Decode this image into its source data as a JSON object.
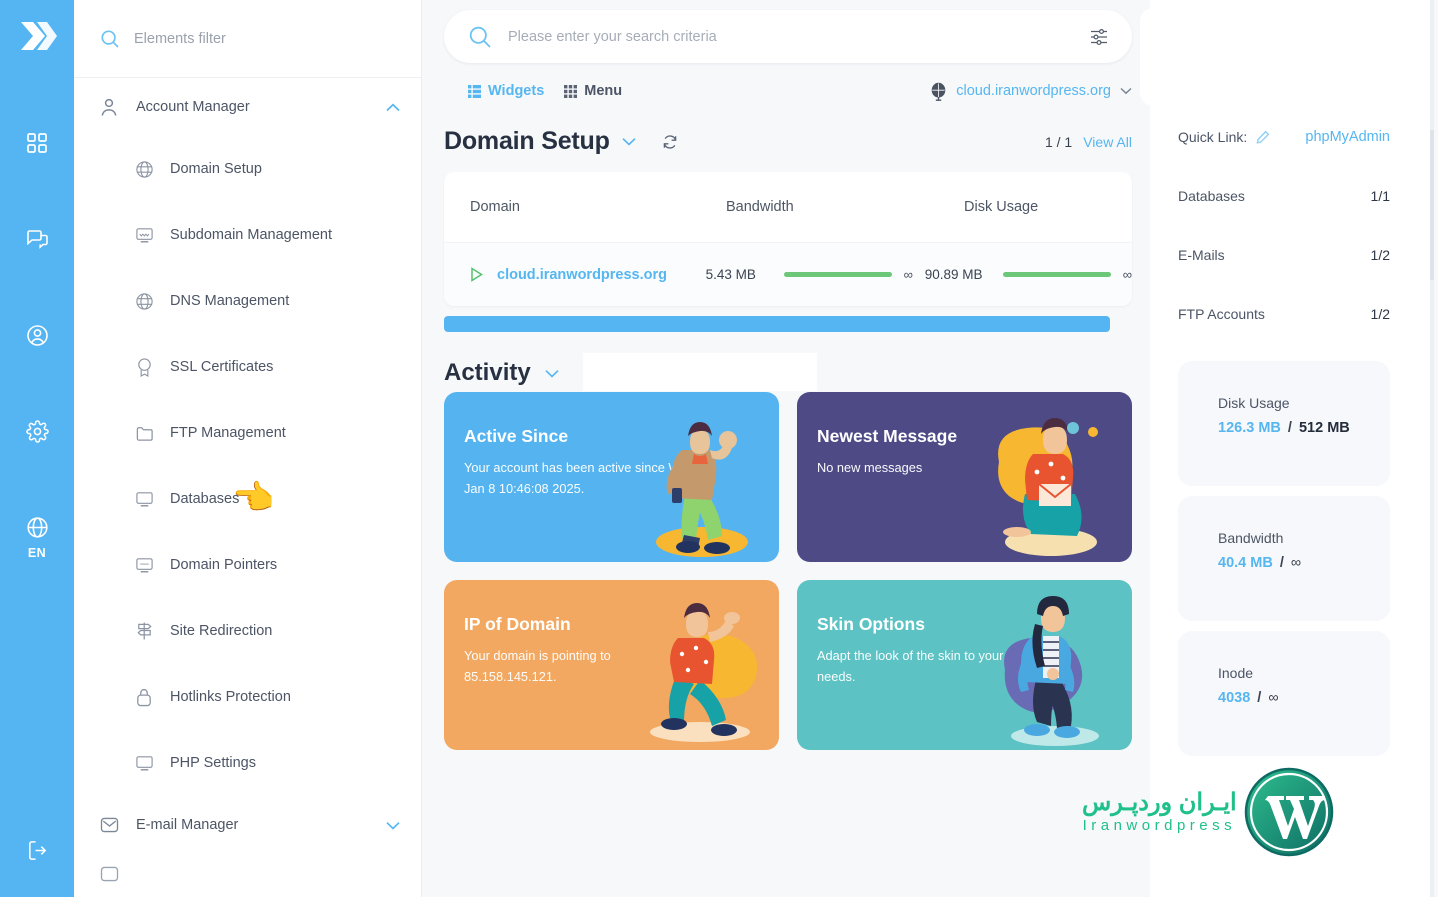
{
  "rail": {
    "logo_name": "directadmin-logo",
    "items": [
      {
        "name": "dashboard-icon",
        "label": "Dashboard"
      },
      {
        "name": "chat-icon",
        "label": "Messages"
      },
      {
        "name": "user-icon",
        "label": "Account"
      },
      {
        "name": "gear-icon",
        "label": "Settings"
      },
      {
        "name": "globe-icon",
        "label": "Language"
      },
      {
        "name": "logout-icon",
        "label": "Logout"
      }
    ],
    "language": "EN"
  },
  "nav": {
    "filter_placeholder": "Elements filter",
    "groups": [
      {
        "label": "Account Manager",
        "icon": "user-outline-icon",
        "expanded": true,
        "chevron": "⌃",
        "items": [
          {
            "label": "Domain Setup",
            "icon": "www-globe-icon"
          },
          {
            "label": "Subdomain Management",
            "icon": "dns-monitor-icon"
          },
          {
            "label": "DNS Management",
            "icon": "dns-globe-icon"
          },
          {
            "label": "SSL Certificates",
            "icon": "ssl-badge-icon"
          },
          {
            "label": "FTP Management",
            "icon": "ftp-folder-icon"
          },
          {
            "label": "Databases",
            "icon": "sql-database-icon"
          },
          {
            "label": "Domain Pointers",
            "icon": "pointer-monitor-icon"
          },
          {
            "label": "Site Redirection",
            "icon": "signpost-icon"
          },
          {
            "label": "Hotlinks Protection",
            "icon": "lock-icon"
          },
          {
            "label": "PHP Settings",
            "icon": "php-monitor-icon"
          }
        ]
      },
      {
        "label": "E-mail Manager",
        "icon": "envelope-icon",
        "expanded": false,
        "chevron": "⌄",
        "items": []
      }
    ],
    "cursor_emoji": "👈"
  },
  "search": {
    "placeholder": "Please enter your search criteria",
    "search_icon": "search-icon",
    "filter_icon": "sliders-icon"
  },
  "toolbar": {
    "widgets_label": "Widgets",
    "menu_label": "Menu",
    "domain": "cloud.iranwordpress.org"
  },
  "section": {
    "title": "Domain Setup",
    "refresh_icon": "refresh-icon",
    "pagination": "1 / 1",
    "view_all": "View All"
  },
  "domain_table": {
    "columns": [
      "Domain",
      "Bandwidth",
      "Disk Usage"
    ],
    "rows": [
      {
        "domain": "cloud.iranwordpress.org",
        "bandwidth_used": "5.43 MB",
        "bandwidth_limit": "∞",
        "disk_used": "90.89 MB",
        "disk_limit": "∞"
      }
    ]
  },
  "activity": {
    "title": "Activity",
    "cards": [
      {
        "title": "Active Since",
        "body": "Your account has been active since Wed Jan 8 10:46:08 2025.",
        "color": "#55b4ef",
        "art": "woman-walking-phone"
      },
      {
        "title": "Newest Message",
        "body": "No new messages",
        "color": "#4e4a86",
        "art": "woman-sitting-envelope"
      },
      {
        "title": "IP of Domain",
        "body": "Your domain is pointing to 85.158.145.121.",
        "color": "#f2a860",
        "art": "woman-running"
      },
      {
        "title": "Skin Options",
        "body": "Adapt the look of the skin to your own needs.",
        "color": "#5cc2c4",
        "art": "man-jacket-walking"
      }
    ]
  },
  "right_panel": {
    "quick_link_label": "Quick Link:",
    "quick_link_edit_icon": "pencil-icon",
    "quick_link_value": "phpMyAdmin",
    "stats": [
      {
        "label": "Databases",
        "value": "1/1"
      },
      {
        "label": "E-Mails",
        "value": "1/2"
      },
      {
        "label": "FTP Accounts",
        "value": "1/2"
      }
    ],
    "resources": [
      {
        "label": "Disk Usage",
        "used": "126.3 MB",
        "sep": "/",
        "total": "512 MB",
        "infinite": false
      },
      {
        "label": "Bandwidth",
        "used": "40.4 MB",
        "sep": "/",
        "total": "∞",
        "infinite": true
      },
      {
        "label": "Inode",
        "used": "4038",
        "sep": "/",
        "total": "∞",
        "infinite": true
      }
    ]
  },
  "watermark": {
    "farsi": "ایـران وردپـرس",
    "english": "Iranwordpress",
    "logo": "wordpress-logo"
  },
  "colors": {
    "accent": "#55b4f2",
    "green": "#6cc878",
    "watermark": "#1fc08a"
  }
}
